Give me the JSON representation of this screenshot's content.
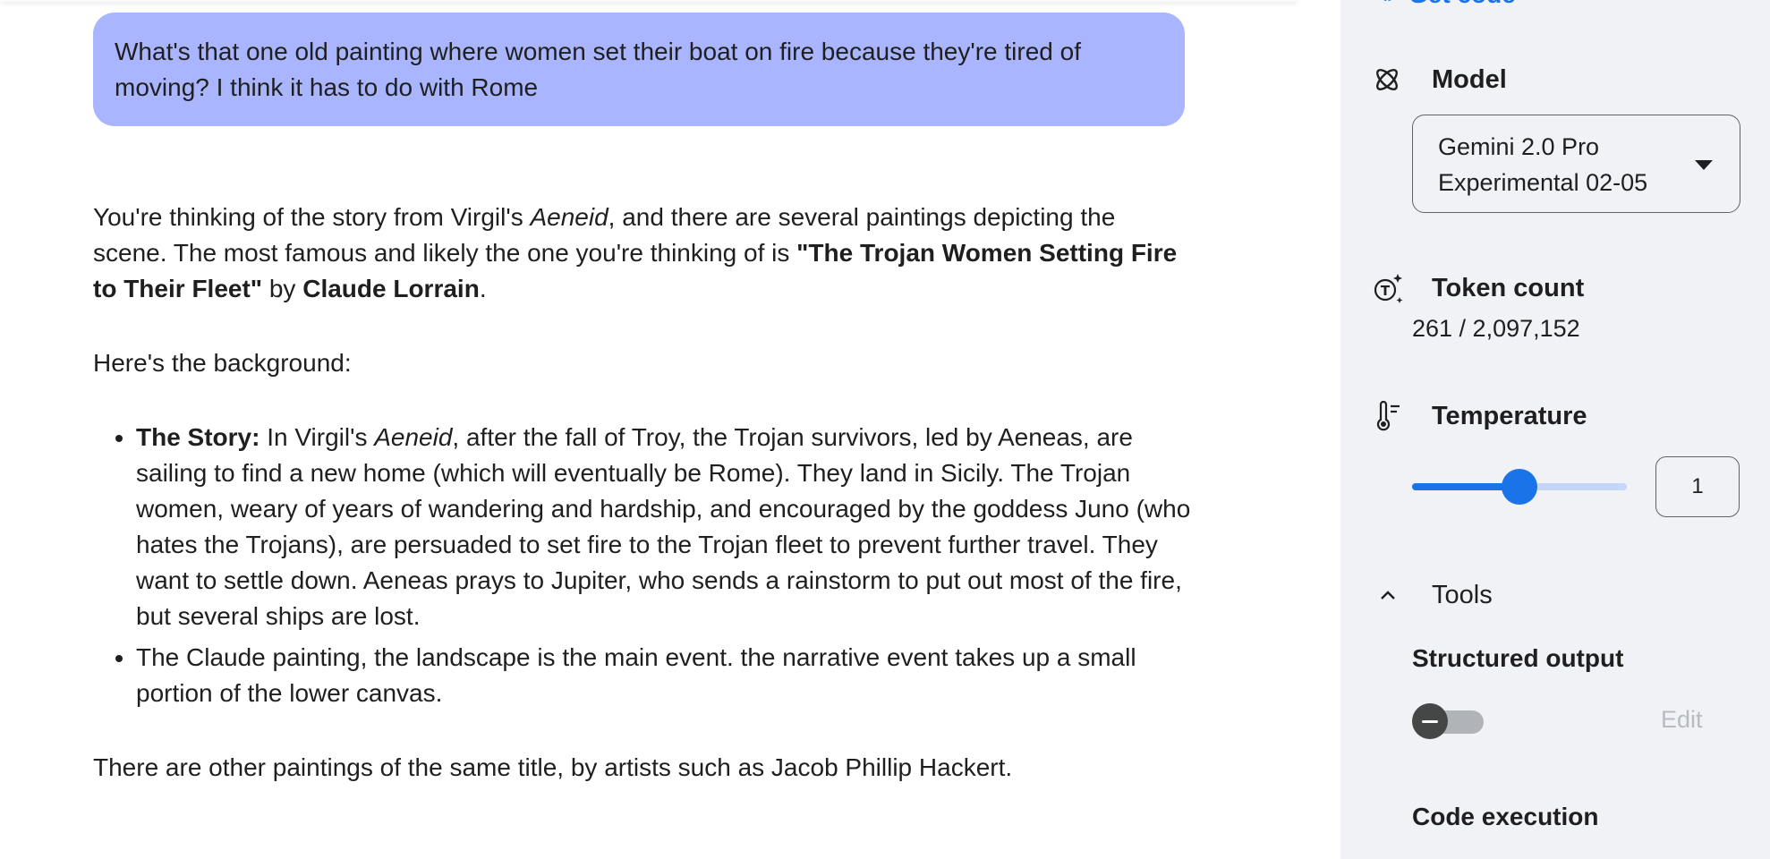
{
  "chat": {
    "user_message": "What's that one old painting where women set their boat on fire because they're tired of moving? I think it has to do with Rome",
    "answer": {
      "p1_a": "You're thinking of the story from Virgil's ",
      "p1_em": "Aeneid",
      "p1_b": ", and there are several paintings depicting the scene. The most famous and likely the one you're thinking of is ",
      "p1_title": "\"The Trojan Women Setting Fire to Their Fleet\"",
      "p1_c": " by ",
      "p1_artist": "Claude Lorrain",
      "p1_d": ".",
      "p2": "Here's the background:",
      "bullet1_label": "The Story:",
      "bullet1_a": " In Virgil's ",
      "bullet1_em": "Aeneid",
      "bullet1_b": ", after the fall of Troy, the Trojan survivors, led by Aeneas, are sailing to find a new home (which will eventually be Rome). They land in Sicily. The Trojan women, weary of years of wandering and hardship, and encouraged by the goddess Juno (who hates the Trojans), are persuaded to set fire to the Trojan fleet to prevent further travel. They want to settle down. Aeneas prays to Jupiter, who sends a rainstorm to put out most of the fire, but several ships are lost.",
      "bullet2": "The Claude painting, the landscape is the main event. the narrative event takes up a small portion of the lower canvas.",
      "p3": "There are other paintings of the same title, by artists such as Jacob Phillip Hackert."
    }
  },
  "panel": {
    "get_code_label": "Get code",
    "model_label": "Model",
    "model_value_line1": "Gemini 2.0 Pro",
    "model_value_line2": "Experimental 02-05",
    "token_label": "Token count",
    "token_value": "261 / 2,097,152",
    "temperature_label": "Temperature",
    "temperature_value": "1",
    "temperature_slider_fraction": 0.5,
    "tools_label": "Tools",
    "structured_output_label": "Structured output",
    "structured_output_enabled": false,
    "edit_label": "Edit",
    "code_execution_label": "Code execution"
  },
  "colors": {
    "user_bubble": "#a9b5ff",
    "accent": "#1a73e8",
    "panel_bg": "#f0f2f6"
  }
}
